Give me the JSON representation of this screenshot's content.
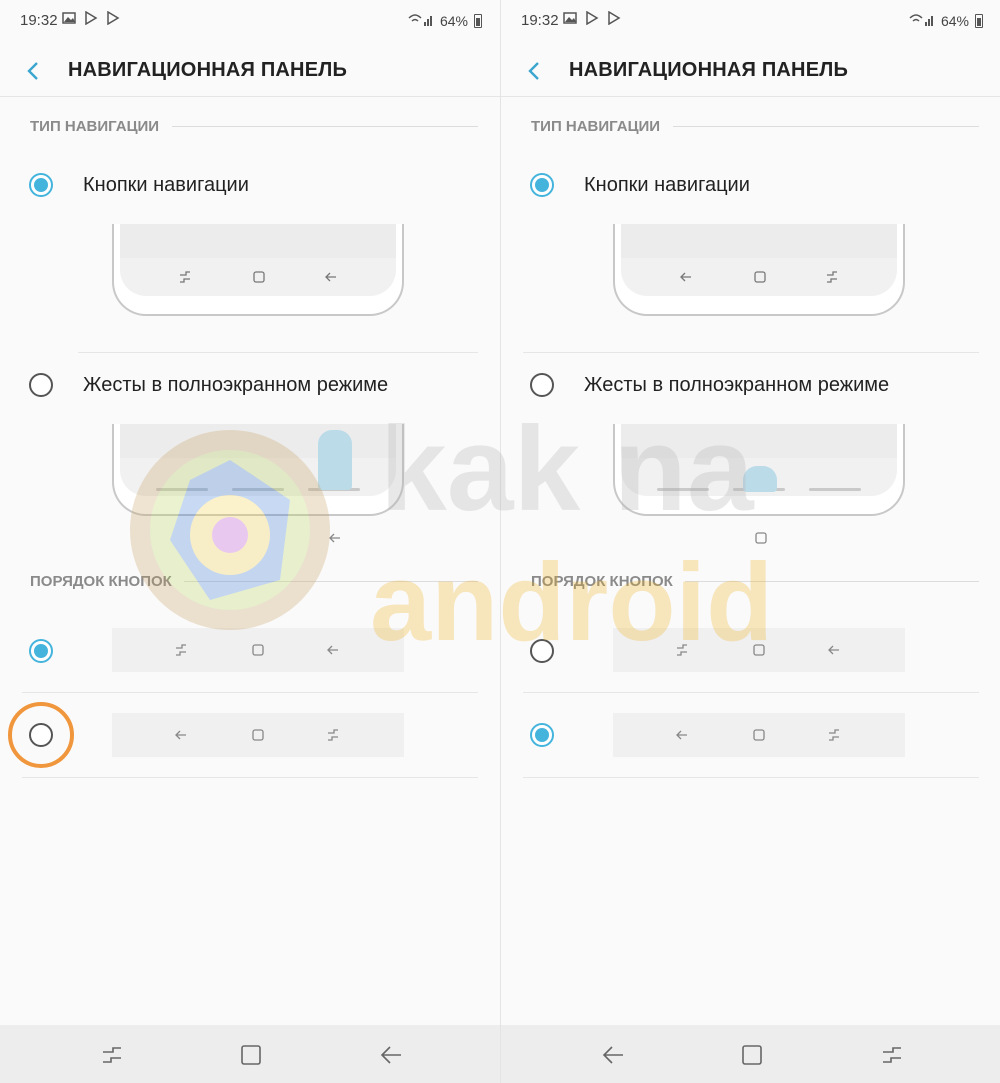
{
  "screens": [
    {
      "status": {
        "time": "19:32",
        "battery": "64%"
      },
      "title": "НАВИГАЦИОННАЯ ПАНЕЛЬ",
      "nav_type_header": "ТИП НАВИГАЦИИ",
      "options": [
        {
          "label": "Кнопки навигации",
          "selected": true
        },
        {
          "label": "Жесты в полноэкранном режиме",
          "selected": false
        }
      ],
      "button_order_header": "ПОРЯДОК КНОПОК",
      "orders": [
        {
          "icons": [
            "recents-icon",
            "home-icon",
            "back-icon"
          ],
          "selected": true
        },
        {
          "icons": [
            "back-icon",
            "home-icon",
            "recents-icon"
          ],
          "selected": false
        }
      ],
      "bottom_nav": [
        "recents-icon",
        "home-icon",
        "back-icon"
      ]
    },
    {
      "status": {
        "time": "19:32",
        "battery": "64%"
      },
      "title": "НАВИГАЦИОННАЯ ПАНЕЛЬ",
      "nav_type_header": "ТИП НАВИГАЦИИ",
      "options": [
        {
          "label": "Кнопки навигации",
          "selected": true
        },
        {
          "label": "Жесты в полноэкранном режиме",
          "selected": false
        }
      ],
      "button_order_header": "ПОРЯДОК КНОПОК",
      "orders": [
        {
          "icons": [
            "recents-icon",
            "home-icon",
            "back-icon"
          ],
          "selected": false
        },
        {
          "icons": [
            "back-icon",
            "home-icon",
            "recents-icon"
          ],
          "selected": true
        }
      ],
      "bottom_nav": [
        "back-icon",
        "home-icon",
        "recents-icon"
      ]
    }
  ],
  "colors": {
    "accent": "#44b4dd",
    "highlight": "#f0963c"
  },
  "watermark": {
    "text_top": "kak na",
    "text_bottom": "android"
  }
}
